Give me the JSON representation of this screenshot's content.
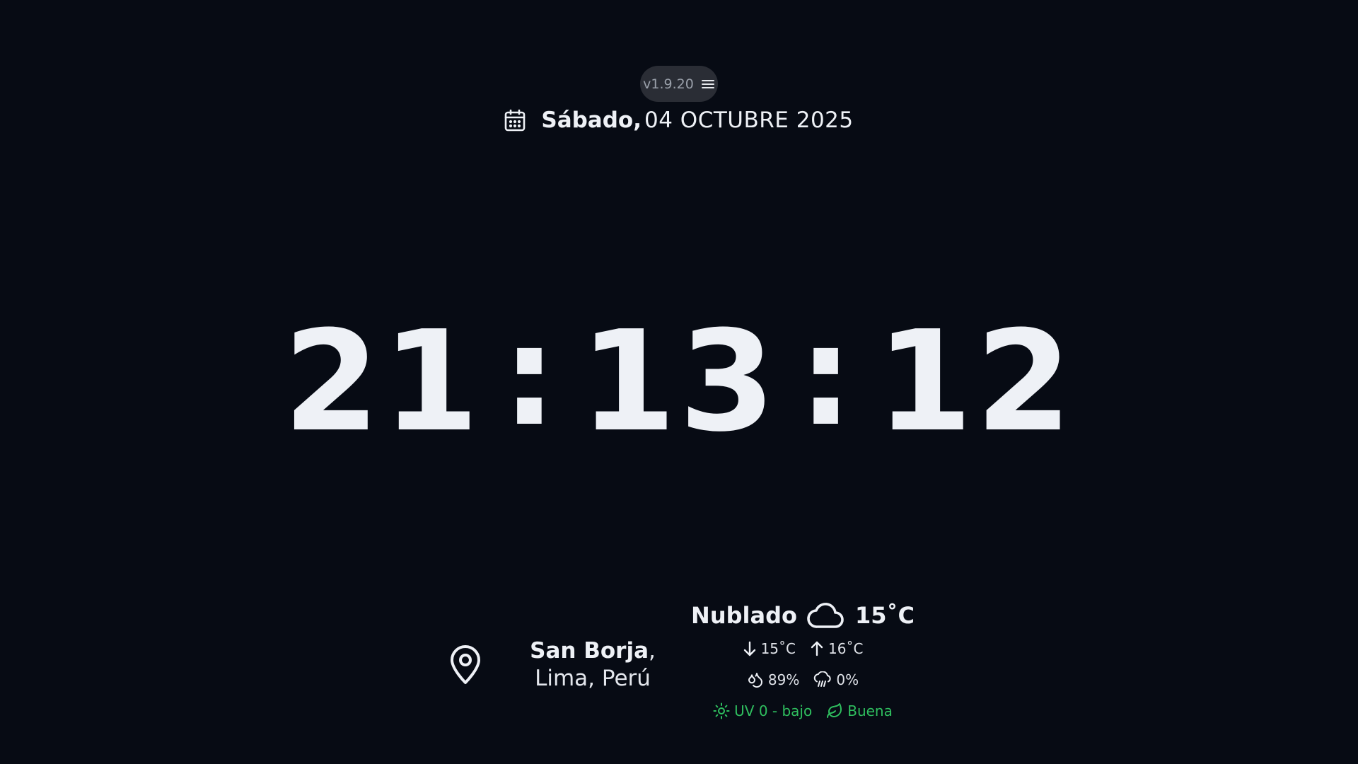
{
  "header": {
    "version": "v1.9.20",
    "day_name": "Sábado,",
    "date": "04 OCTUBRE 2025"
  },
  "clock": {
    "hours": "21",
    "minutes": "13",
    "seconds": "12",
    "separator": ":"
  },
  "location": {
    "district": "San Borja",
    "rest": ", Lima, Perú"
  },
  "weather": {
    "condition": "Nublado",
    "temperature": "15˚C",
    "temp_min": "15˚C",
    "temp_max": "16˚C",
    "humidity": "89%",
    "rain_chance": "0%",
    "uv": "UV 0 - bajo",
    "air_quality": "Buena"
  },
  "colors": {
    "background": "#070b14",
    "text": "#eef1f6",
    "pill": "#2a2d35",
    "good": "#2fbf5f"
  },
  "icons": {
    "menu": "menu-icon",
    "calendar": "calendar-icon",
    "location": "location-pin-icon",
    "cloud": "cloud-icon",
    "arrow_down": "arrow-down-icon",
    "arrow_up": "arrow-up-icon",
    "humidity": "droplets-icon",
    "rain": "cloud-rain-icon",
    "uv": "sun-icon",
    "air": "leaf-icon"
  }
}
